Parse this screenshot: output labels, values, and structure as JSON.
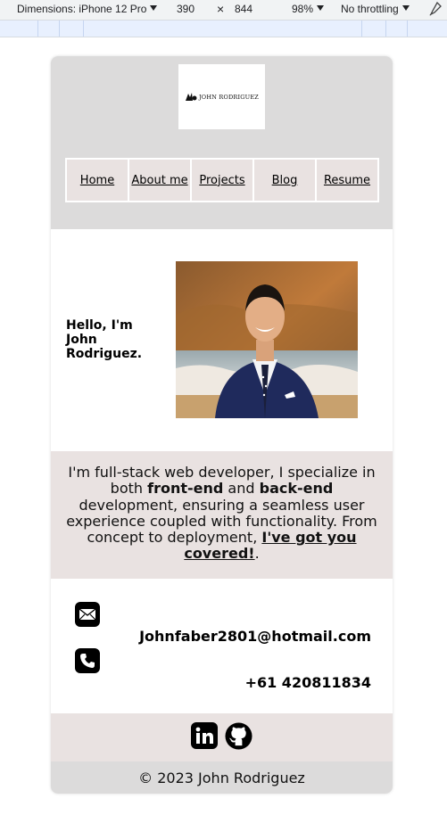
{
  "devtools": {
    "dimensions_label": "Dimensions: iPhone 12 Pro",
    "width": "390",
    "times": "×",
    "height": "844",
    "zoom": "98%",
    "throttling": "No throttling"
  },
  "logo": {
    "text": "JOHN RODRIGUEZ"
  },
  "nav": [
    {
      "label": "Home"
    },
    {
      "label": "About me"
    },
    {
      "label": "Projects"
    },
    {
      "label": "Blog"
    },
    {
      "label": "Resume"
    }
  ],
  "hero": {
    "greeting": "Hello, I'm John Rodriguez."
  },
  "about": {
    "part1": "I'm full-stack web developer, I specialize in both ",
    "front": "front-end",
    "and": " and ",
    "back": "back-end",
    "part2": " development, ensuring a seamless user experience coupled with functionality. From concept to deployment, ",
    "link": "I've got you covered!",
    "end": "."
  },
  "contact": {
    "email": "Johnfaber2801@hotmail.com",
    "phone": "+61 420811834"
  },
  "footer": {
    "text": "© 2023 John Rodriguez"
  },
  "colors": {
    "header_bg": "#dcdbdb",
    "nav_bg": "#e9e2e1",
    "section_bg": "#e9e2e1"
  }
}
